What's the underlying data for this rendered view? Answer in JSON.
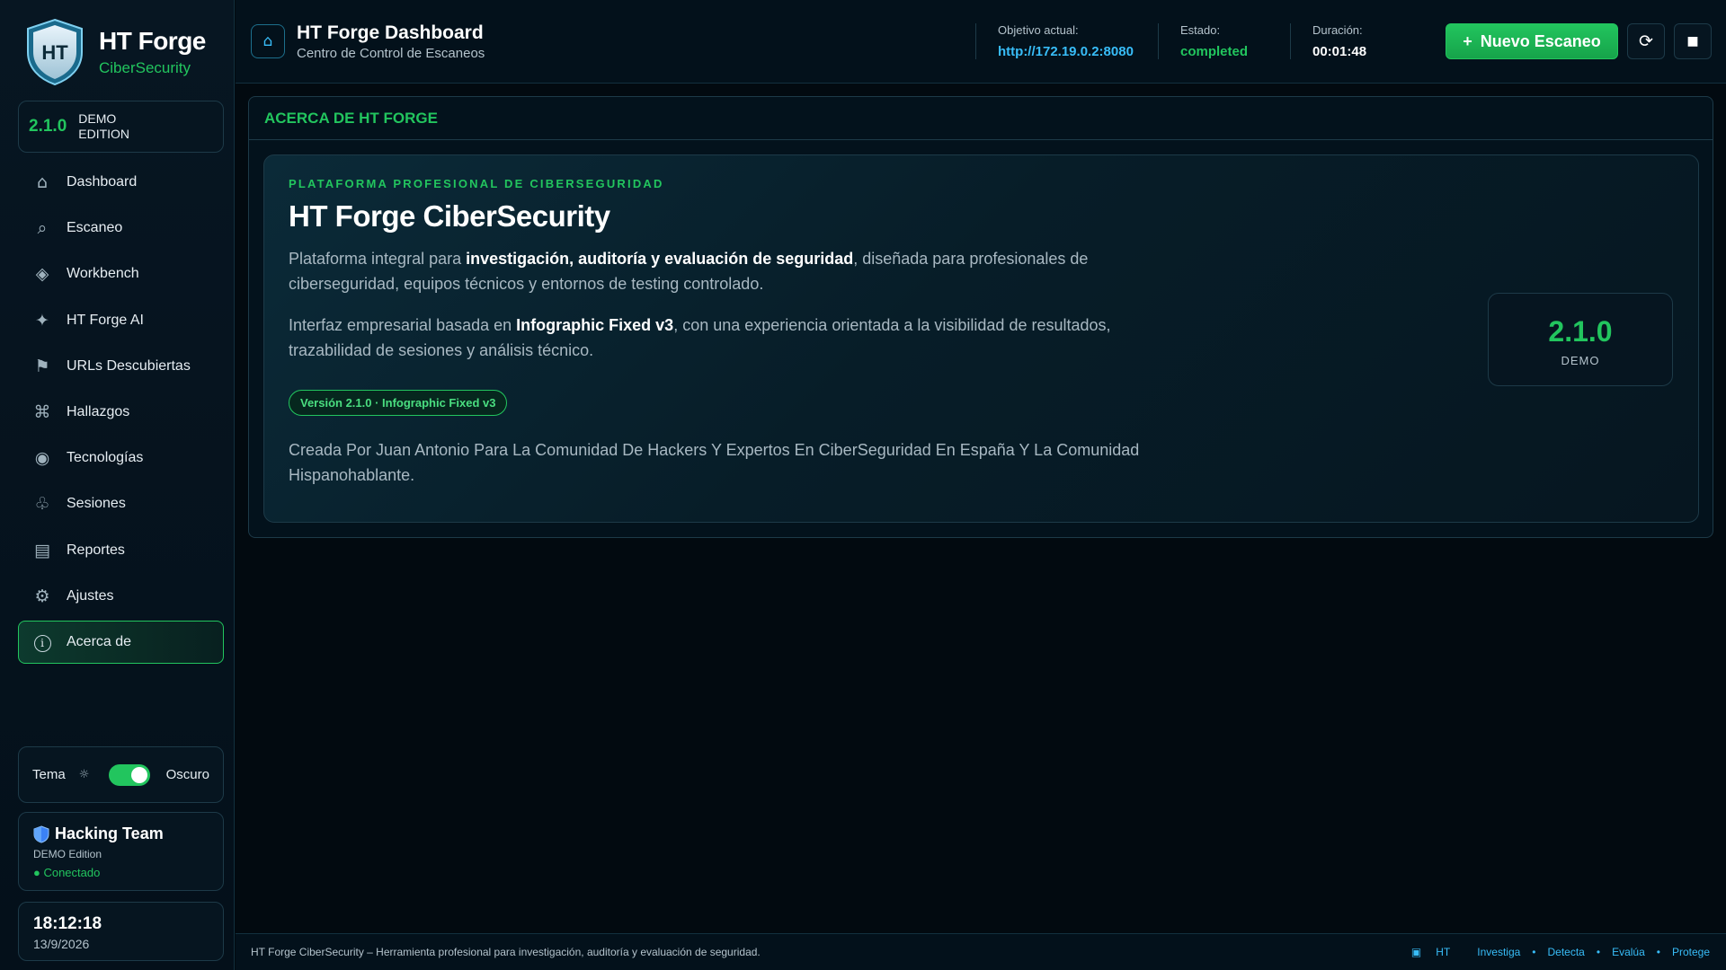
{
  "sidebar": {
    "brand": {
      "name": "HT Forge",
      "subtitle": "CiberSecurity",
      "logo_text": "HT"
    },
    "version": {
      "number": "2.1.0",
      "edition": "DEMO EDITION"
    },
    "items": [
      {
        "label": "Dashboard",
        "icon": "home-icon",
        "glyph": "⌂"
      },
      {
        "label": "Escaneo",
        "icon": "search-icon",
        "glyph": "⌕"
      },
      {
        "label": "Workbench",
        "icon": "diamond-icon",
        "glyph": "◈"
      },
      {
        "label": "HT Forge AI",
        "icon": "sparkle-icon",
        "glyph": "✦"
      },
      {
        "label": "URLs Descubiertas",
        "icon": "flag-icon",
        "glyph": "⚑"
      },
      {
        "label": "Hallazgos",
        "icon": "command-icon",
        "glyph": "⌘"
      },
      {
        "label": "Tecnologías",
        "icon": "radio-icon",
        "glyph": "◉"
      },
      {
        "label": "Sesiones",
        "icon": "users-icon",
        "glyph": "♧"
      },
      {
        "label": "Reportes",
        "icon": "document-icon",
        "glyph": "▤"
      },
      {
        "label": "Ajustes",
        "icon": "gear-icon",
        "glyph": "⚙"
      },
      {
        "label": "Acerca de",
        "icon": "info-icon",
        "glyph": "i",
        "active": true
      }
    ],
    "theme": {
      "label": "Tema",
      "sun_glyph": "☼",
      "value": "Oscuro",
      "enabled": true
    },
    "team": {
      "name": "Hacking Team",
      "edition": "DEMO Edition",
      "status": "● Conectado"
    },
    "clock": {
      "time": "18:12:18",
      "date": "13/9/2026"
    }
  },
  "header": {
    "home_glyph": "⌂",
    "title": "HT Forge Dashboard",
    "subtitle": "Centro de Control de Escaneos",
    "target": {
      "label": "Objetivo actual:",
      "value": "http://172.19.0.2:8080"
    },
    "state": {
      "label": "Estado:",
      "value": "completed"
    },
    "duration": {
      "label": "Duración:",
      "value": "00:01:48"
    },
    "new_scan": {
      "plus": "+",
      "label": "Nuevo Escaneo"
    },
    "refresh_glyph": "⟳",
    "stop_glyph": "■"
  },
  "panel": {
    "title": "ACERCA DE HT FORGE",
    "eyebrow": "PLATAFORMA PROFESIONAL DE CIBERSEGURIDAD",
    "title_main": "HT Forge CiberSecurity",
    "para1": {
      "pre": "Plataforma integral para ",
      "strong": "investigación, auditoría y evaluación de seguridad",
      "post": ", diseñada para profesionales de ciberseguridad, equipos técnicos y entornos de testing controlado."
    },
    "para2": {
      "pre": "Interfaz empresarial basada en ",
      "strong": "Infographic Fixed v3",
      "post": ", con una experiencia orientada a la visibilidad de resultados, trazabilidad de sesiones y análisis técnico."
    },
    "badge": "Versión 2.1.0 · Infographic Fixed v3",
    "para3": "Creada Por Juan Antonio Para La Comunidad De Hackers Y Expertos En CiberSeguridad En España Y La Comunidad Hispanohablante.",
    "version_card": {
      "number": "2.1.0",
      "label": "DEMO"
    }
  },
  "footer": {
    "text": "HT Forge CiberSecurity – Herramienta profesional para investigación, auditoría y evaluación de seguridad.",
    "ht_glyph": "▣",
    "ht": "HT",
    "links": [
      "Investiga",
      "Detecta",
      "Evalúa",
      "Protege"
    ],
    "sep": "•"
  },
  "colors": {
    "accent": "#22c55e",
    "link": "#38bdf8",
    "background": "#020a10",
    "panel": "#03121c",
    "border": "#1d3a48"
  }
}
